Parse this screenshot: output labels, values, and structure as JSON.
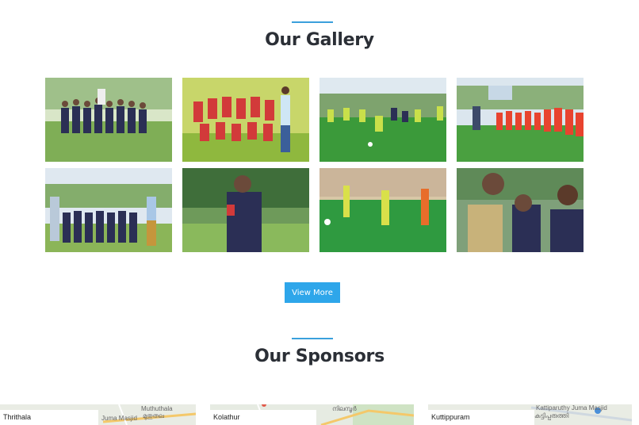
{
  "gallery": {
    "title": "Our Gallery",
    "accent": "#3aa0dc",
    "photos": [
      {
        "icon": "team-photo-icon"
      },
      {
        "icon": "team-photo-icon"
      },
      {
        "icon": "match-photo-icon"
      },
      {
        "icon": "team-line-photo-icon"
      },
      {
        "icon": "team-photo-icon"
      },
      {
        "icon": "player-portrait-icon"
      },
      {
        "icon": "match-photo-icon"
      },
      {
        "icon": "officer-photo-icon"
      }
    ],
    "view_more_label": "View More",
    "button_color": "#2ea6ea"
  },
  "sponsors": {
    "title": "Our Sponsors",
    "items": [
      {
        "label": "Thrithala",
        "map_top": "Muthuthala",
        "map_mid": "Juma Masjid",
        "map_mal": "മുതുതല"
      },
      {
        "label": "Kolathur",
        "map_top": "",
        "map_mid": "",
        "map_mal": "നിലമ്പൂർ"
      },
      {
        "label": "Kuttippuram",
        "map_top": "Kattiparuthy Juma Masjid",
        "map_mid": "",
        "map_mal": "കട്ടിപ്പരുത്തി"
      }
    ]
  }
}
